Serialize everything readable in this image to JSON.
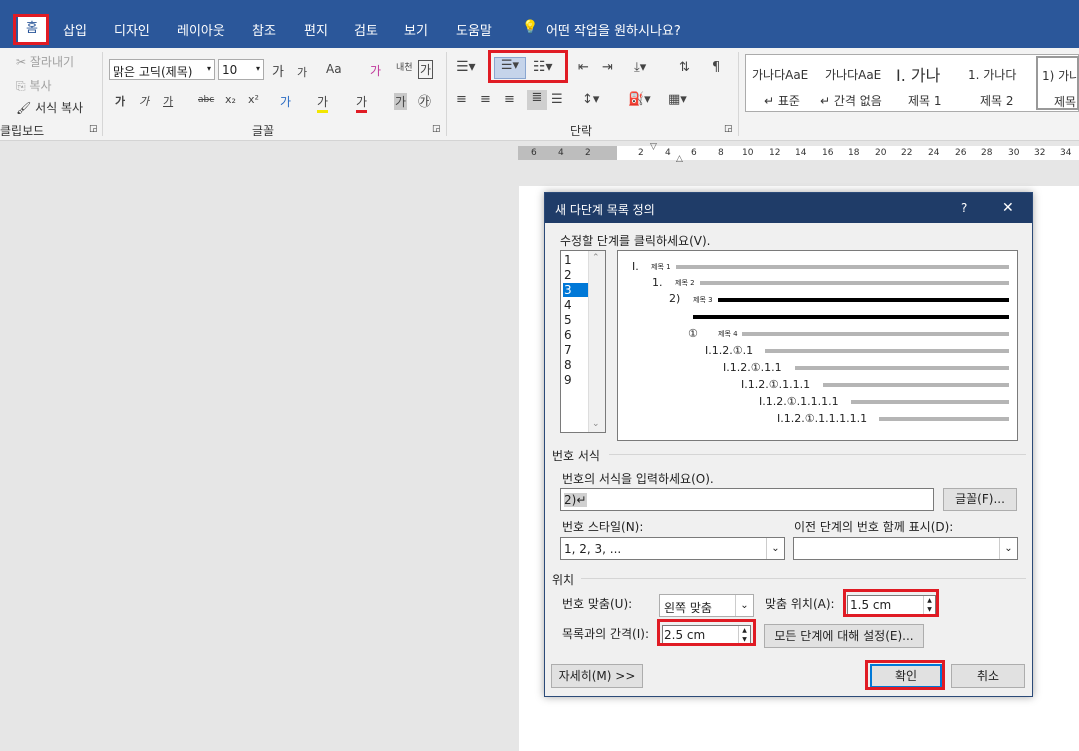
{
  "ribbon_tabs": [
    "홈",
    "삽입",
    "디자인",
    "레이아웃",
    "참조",
    "편지",
    "검토",
    "보기",
    "도움말"
  ],
  "tell_me": "어떤 작업을 원하시나요?",
  "clipboard": {
    "cut": "잘라내기",
    "copy": "복사",
    "format_painter": "서식 복사",
    "group": "클립보드"
  },
  "font": {
    "name": "맑은 고딕(제목)",
    "size": "10",
    "group": "글꼴",
    "grow": "가",
    "shrink": "가",
    "case": "Aa",
    "clear": "가",
    "phonetic": "내천",
    "border_char": "가",
    "bold": "가",
    "italic": "가",
    "underline": "가",
    "strike": "abc",
    "sub": "x₂",
    "sup": "x²",
    "effects": "가",
    "highlight": "가",
    "color": "가",
    "shade": "가",
    "enclose": "㉮"
  },
  "paragraph": {
    "group": "단락"
  },
  "styles": [
    {
      "preview": "가나다AaE",
      "name": "↵ 표준"
    },
    {
      "preview": "가나다AaE",
      "name": "↵ 간격 없음"
    },
    {
      "preview": "I. 가나",
      "name": "제목 1"
    },
    {
      "preview": "1. 가나다",
      "name": "제목 2"
    },
    {
      "preview": "1) 가나",
      "name": "제목"
    }
  ],
  "ruler": [
    "6",
    "4",
    "2",
    "2",
    "4",
    "6",
    "8",
    "10",
    "12",
    "14",
    "16",
    "18",
    "20",
    "22",
    "24",
    "26",
    "28",
    "30",
    "32",
    "34"
  ],
  "dialog": {
    "title": "새 다단계 목록 정의",
    "help": "?",
    "close": "✕",
    "click_level_label": "수정할 단계를 클릭하세요(V).",
    "levels": [
      "1",
      "2",
      "3",
      "4",
      "5",
      "6",
      "7",
      "8",
      "9"
    ],
    "preview": [
      {
        "num": "I.",
        "text": "제목 1"
      },
      {
        "num": "1.",
        "text": "제목 2"
      },
      {
        "num": "2)",
        "text": "제목 3"
      },
      {
        "num": "①",
        "text": "제목 4"
      },
      {
        "num": "I.1.2.①.1",
        "text": ""
      },
      {
        "num": "I.1.2.①.1.1",
        "text": ""
      },
      {
        "num": "I.1.2.①.1.1.1",
        "text": ""
      },
      {
        "num": "I.1.2.①.1.1.1.1",
        "text": ""
      },
      {
        "num": "I.1.2.①.1.1.1.1.1",
        "text": ""
      }
    ],
    "number_format_section": "번호 서식",
    "enter_format_label": "번호의 서식을 입력하세요(O).",
    "format_value": "2)↵",
    "font_button": "글꼴(F)...",
    "number_style_label": "번호 스타일(N):",
    "number_style_value": "1, 2, 3, ...",
    "include_prev_label": "이전 단계의 번호 함께 표시(D):",
    "include_prev_value": "",
    "position_section": "위치",
    "alignment_label": "번호 맞춤(U):",
    "alignment_value": "왼쪽 맞춤",
    "aligned_at_label": "맞춤 위치(A):",
    "aligned_at_value": "1.5 cm",
    "indent_label": "목록과의 간격(I):",
    "indent_value": "2.5 cm",
    "set_all_button": "모든 단계에 대해 설정(E)...",
    "more_button": "자세히(M) >>",
    "ok_button": "확인",
    "cancel_button": "취소"
  }
}
